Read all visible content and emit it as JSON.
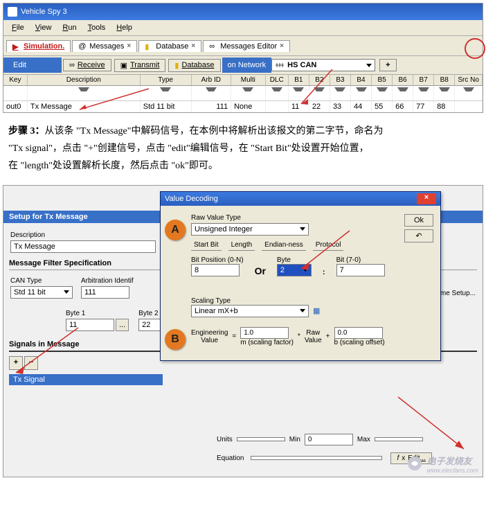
{
  "top": {
    "title": "Vehicle Spy 3",
    "menu": [
      "File",
      "View",
      "Run",
      "Tools",
      "Help"
    ],
    "tabs": [
      {
        "label": "Simulation."
      },
      {
        "label": "Messages"
      },
      {
        "label": "Database"
      },
      {
        "label": "Messages Editor"
      }
    ],
    "edit_label": "Edit",
    "btn_receive": "Receive",
    "btn_transmit": "Transmit",
    "btn_database": "Database",
    "on_network": "on Network",
    "network_sel": "HS CAN",
    "plus": "+"
  },
  "grid": {
    "cols": [
      "Key",
      "Description",
      "",
      "Type",
      "",
      "Arb ID",
      "Multi",
      "",
      "DLC",
      "B1",
      "B2",
      "B3",
      "B4",
      "B5",
      "B6",
      "B7",
      "B8",
      "Src No"
    ],
    "row": {
      "key": "out0",
      "desc": "Tx Message",
      "type": "Std 11 bit",
      "arb": "111",
      "multi": "None",
      "dlc": "",
      "b": [
        "11",
        "22",
        "33",
        "44",
        "55",
        "66",
        "77",
        "88"
      ]
    }
  },
  "step": {
    "heading": "步骤 3：",
    "line1": "从该条 \"Tx Message\"中解码信号，在本例中将解析出该报文的第二字节，命名为",
    "line2": "\"Tx signal\"，点击 \"+\"创建信号，点击 \"edit\"编辑信号，在 \"Start Bit\"处设置开始位置，",
    "line3": "在 \"length\"处设置解析长度，然后点击 \"ok\"即可。"
  },
  "setup": {
    "title": "Setup for Tx Message",
    "desc_label": "Description",
    "desc_val": "Tx Message",
    "filter_hdr": "Message Filter Specification",
    "cantype_label": "CAN Type",
    "cantype_val": "Std 11 bit",
    "arb_label": "Arbitration Identif",
    "arb_val": "111",
    "multiframe": "ultiframe Setup...",
    "byte1_label": "Byte 1",
    "byte1_val": "11",
    "byte2_label": "Byte 2",
    "byte2_val": "22",
    "sigs_hdr": "Signals in Message",
    "sig_name": "Tx Signal",
    "units_label": "Units",
    "units_val": "",
    "min_label": "Min",
    "min_val": "0",
    "max_label": "Max",
    "max_val": "",
    "eq_label": "Equation",
    "edit_btn": "Edit..."
  },
  "dialog": {
    "title": "Value Decoding",
    "ok": "Ok",
    "rawtype_label": "Raw Value Type",
    "rawtype_val": "Unsigned Integer",
    "tabs": [
      "Start Bit",
      "Length",
      "Endian-ness",
      "Protocol"
    ],
    "bitpos_label": "Bit Position (0-N)",
    "bitpos_val": "8",
    "or": "Or",
    "byte_label": "Byte",
    "byte_val": "2",
    "bit_label": "Bit (7-0)",
    "bit_val": "7",
    "scaling_label": "Scaling Type",
    "scaling_val": "Linear mX+b",
    "eng_label": "Engineering\nValue",
    "eq": "=",
    "star": "*",
    "plus": "+",
    "m_val": "1.0",
    "m_note": "m (scaling factor)",
    "raw_label": "Raw\nValue",
    "b_val": "0.0",
    "b_note": "b (scaling offset)",
    "bubbleA": "A",
    "bubbleB": "B"
  },
  "footer": {
    "brand": "电子发烧友",
    "url": "www.elecfans.com"
  }
}
